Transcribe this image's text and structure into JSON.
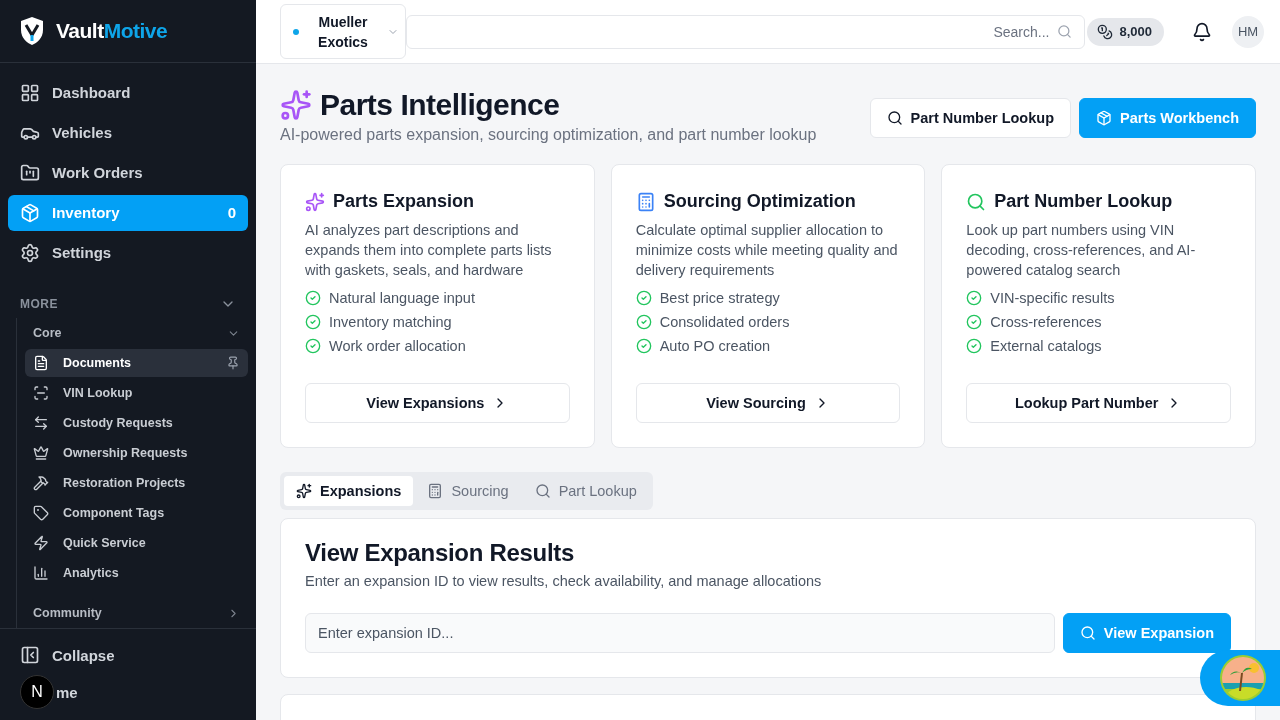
{
  "brand": {
    "first": "Vault",
    "second": "Motive"
  },
  "nav": [
    {
      "label": "Dashboard",
      "selected": false
    },
    {
      "label": "Vehicles",
      "selected": false
    },
    {
      "label": "Work Orders",
      "selected": false
    },
    {
      "label": "Inventory",
      "selected": true,
      "count": "0"
    },
    {
      "label": "Settings",
      "selected": false
    }
  ],
  "more": {
    "label": "MORE",
    "expanded": true,
    "groups": [
      {
        "label": "Core",
        "expanded": true,
        "items": [
          {
            "label": "Documents",
            "selected": true,
            "pinned": true
          },
          {
            "label": "VIN Lookup",
            "selected": false
          },
          {
            "label": "Custody Requests",
            "selected": false
          },
          {
            "label": "Ownership Requests",
            "selected": false
          },
          {
            "label": "Restoration Projects",
            "selected": false
          },
          {
            "label": "Component Tags",
            "selected": false
          },
          {
            "label": "Quick Service",
            "selected": false
          },
          {
            "label": "Analytics",
            "selected": false
          }
        ]
      },
      {
        "label": "Community",
        "expanded": false
      }
    ]
  },
  "sidebar_footer": {
    "collapse": "Collapse",
    "theme": "me",
    "badge": "N"
  },
  "topbar": {
    "shop": {
      "name": "Mueller Exotics",
      "color": "#0ea5e9"
    },
    "search": {
      "placeholder": "Search..."
    },
    "credits": "8,000",
    "avatar": "HM"
  },
  "header": {
    "title": "Parts Intelligence",
    "subtitle": "AI-powered parts expansion, sourcing optimization, and part number lookup",
    "buttons": [
      {
        "label": "Part Number Lookup",
        "kind": "outline"
      },
      {
        "label": "Parts Workbench",
        "kind": "primary"
      }
    ]
  },
  "cards": [
    {
      "title": "Parts Expansion",
      "text": "AI analyzes part descriptions and expands them into complete parts lists with gaskets, seals, and hardware",
      "features": [
        "Natural language input",
        "Inventory matching",
        "Work order allocation"
      ],
      "action": "View Expansions"
    },
    {
      "title": "Sourcing Optimization",
      "text": "Calculate optimal supplier allocation to minimize costs while meeting quality and delivery requirements",
      "features": [
        "Best price strategy",
        "Consolidated orders",
        "Auto PO creation"
      ],
      "action": "View Sourcing"
    },
    {
      "title": "Part Number Lookup",
      "text": "Look up part numbers using VIN decoding, cross-references, and AI-powered catalog search",
      "features": [
        "VIN-specific results",
        "Cross-references",
        "External catalogs"
      ],
      "action": "Lookup Part Number"
    }
  ],
  "tabs": [
    {
      "label": "Expansions",
      "selected": true
    },
    {
      "label": "Sourcing",
      "selected": false
    },
    {
      "label": "Part Lookup",
      "selected": false
    }
  ],
  "results": {
    "title": "View Expansion Results",
    "text": "Enter an expansion ID to view results, check availability, and manage allocations",
    "input": {
      "placeholder": "Enter expansion ID..."
    },
    "button": "View Expansion"
  }
}
